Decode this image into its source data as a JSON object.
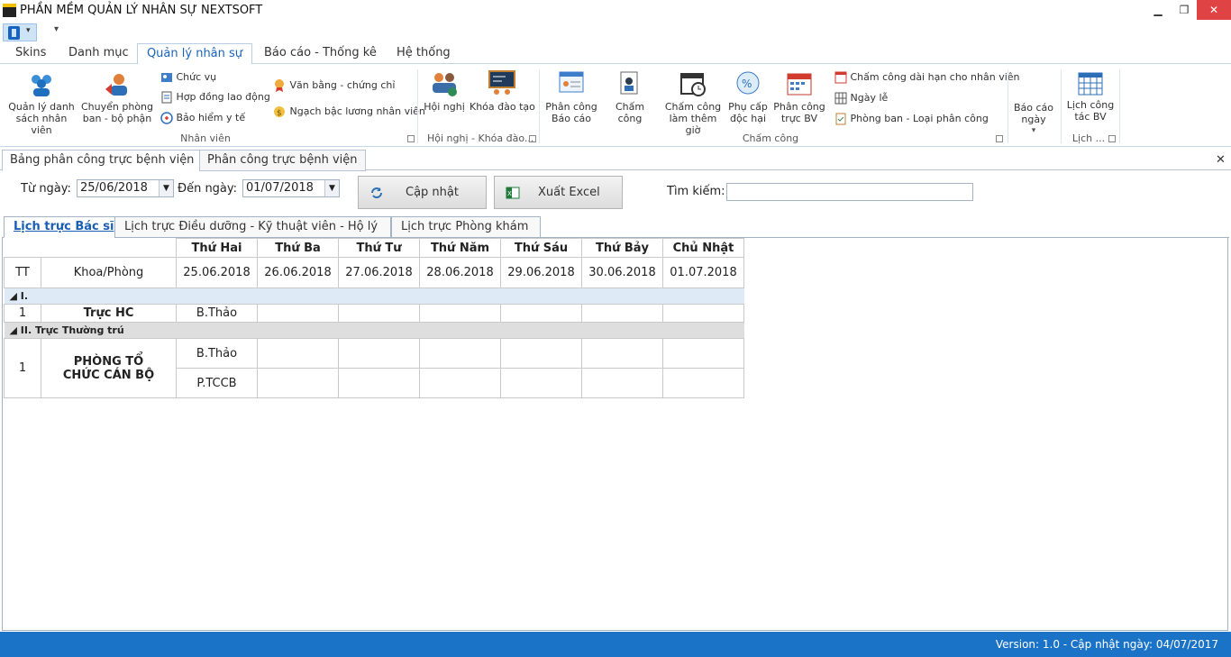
{
  "window": {
    "title": "PHẦN MỀM QUẢN LÝ NHÂN SỰ NEXTSOFT",
    "minimize": "▁",
    "maximize": "❐",
    "close": "✕"
  },
  "menu": [
    "Skins",
    "Danh mục",
    "Quản lý nhân sự",
    "Báo cáo - Thống kê",
    "Hệ thống"
  ],
  "ribbon": {
    "nhan_vien": {
      "group": "Nhân viên",
      "danh_sach": "Quản lý danh sách nhân viên",
      "chuyen_phong": "Chuyển phòng ban - bộ phận",
      "chuc_vu": "Chức vụ",
      "hop_dong": "Hợp đồng lao động",
      "bao_hiem": "Bảo hiểm y tế",
      "van_bang": "Văn bằng - chứng chỉ",
      "ngach_bac": "Ngạch bậc lương nhân viên"
    },
    "hoi_nghi": {
      "group": "Hội nghị - Khóa đào...",
      "hoi_nghi": "Hội nghị",
      "khoa_dao_tao": "Khóa đào tạo"
    },
    "cham_cong": {
      "group": "Chấm công",
      "phan_cong_bc": "Phân công Báo cáo",
      "cham_cong": "Chấm công",
      "them_gio": "Chấm công làm thêm giờ",
      "phu_cap": "Phụ cấp độc hại",
      "phan_cong_truc": "Phân công trực BV",
      "dai_han": "Chấm công dài hạn cho nhân viên",
      "ngay_le": "Ngày lễ",
      "phong_ban": "Phòng ban - Loại phân công"
    },
    "bao_cao": {
      "label": "Báo cáo ngày",
      "arrow": "▾"
    },
    "lich": {
      "group": "Lịch ...",
      "label": "Lịch công tác BV"
    }
  },
  "doc_tabs": [
    "Bảng phân công trực bệnh viện",
    "Phân công trực bệnh viện"
  ],
  "filter": {
    "from_label": "Từ ngày:",
    "from_value": "25/06/2018",
    "to_label": "Đến ngày:",
    "to_value": "01/07/2018",
    "update_btn": "Cập nhật",
    "excel_btn": "Xuất Excel",
    "search_label": "Tìm kiếm:",
    "search_value": ""
  },
  "sub_tabs": [
    "Lịch trực Bác sĩ",
    "Lịch trực Điều dưỡng - Kỹ thuật viên - Hộ lý",
    "Lịch trực Phòng khám"
  ],
  "grid": {
    "days": [
      "Thứ Hai",
      "Thứ Ba",
      "Thứ Tư",
      "Thứ Năm",
      "Thứ Sáu",
      "Thứ Bảy",
      "Chủ Nhật"
    ],
    "tt": "TT",
    "khoa": "Khoa/Phòng",
    "dates": [
      "25.06.2018",
      "26.06.2018",
      "27.06.2018",
      "28.06.2018",
      "29.06.2018",
      "30.06.2018",
      "01.07.2018"
    ],
    "group1": "◢ I.",
    "g1_row": {
      "tt": "1",
      "khoa": "Trực HC",
      "mon": "B.Thảo"
    },
    "group2": "◢ II. Trực Thường trú",
    "g2_row": {
      "tt": "1",
      "khoa": "PHÒNG TỔ CHỨC CÁN BỘ",
      "mon1": "B.Thảo",
      "mon2": "P.TCCB"
    }
  },
  "status": "Version: 1.0 - Cập nhật ngày: 04/07/2017"
}
